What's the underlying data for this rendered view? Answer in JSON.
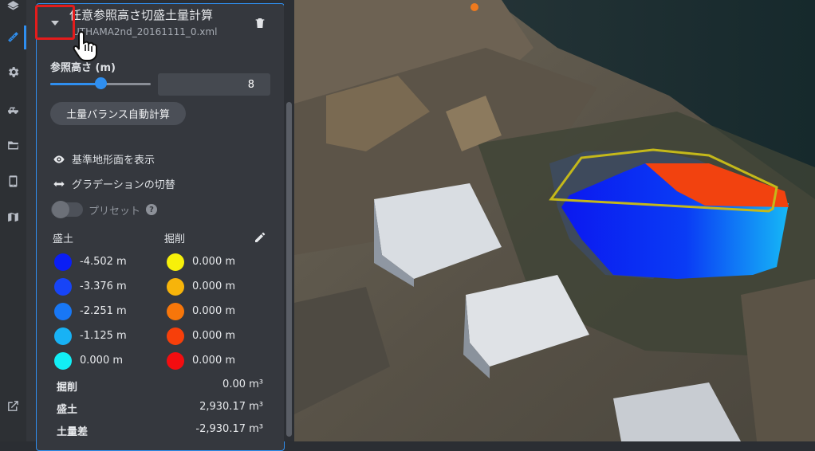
{
  "panel": {
    "title": "任意参照高さ切盛土量計算",
    "subtitle": "UTHAMA2nd_20161111_0.xml",
    "ref_height_label": "参照高さ (m)",
    "ref_height_value": "8",
    "slider_level": 0.5,
    "auto_balance_button": "土量バランス自動計算",
    "show_base_surface": "基準地形面を表示",
    "toggle_gradation": "グラデーションの切替",
    "preset_label": "プリセット",
    "preset_help": "?",
    "fill_header": "盛土",
    "cut_header": "掘削",
    "fill_colors": [
      {
        "label": "-4.502 m",
        "color": "#0a1ef5"
      },
      {
        "label": "-3.376 m",
        "color": "#1744f7"
      },
      {
        "label": "-2.251 m",
        "color": "#1877f5"
      },
      {
        "label": "-1.125 m",
        "color": "#18b2f5"
      },
      {
        "label": "0.000 m",
        "color": "#12eef5"
      }
    ],
    "cut_colors": [
      {
        "label": "0.000 m",
        "color": "#f7f00a"
      },
      {
        "label": "0.000 m",
        "color": "#f7b40a"
      },
      {
        "label": "0.000 m",
        "color": "#f7760a"
      },
      {
        "label": "0.000 m",
        "color": "#f73f0a"
      },
      {
        "label": "0.000 m",
        "color": "#f30d10"
      }
    ],
    "summary": [
      {
        "label": "掘削",
        "value": "0.00 m³"
      },
      {
        "label": "盛土",
        "value": "2,930.17 m³"
      },
      {
        "label": "土量差",
        "value": "-2,930.17 m³"
      }
    ]
  },
  "rail_icons": [
    "layers-icon",
    "measure-icon",
    "settings-icon",
    "vehicle-icon",
    "folder-icon",
    "mobile-icon",
    "map-icon",
    "external-link-icon"
  ],
  "colors": {
    "accent": "#2f8ff0",
    "highlight": "#e41c1c"
  }
}
